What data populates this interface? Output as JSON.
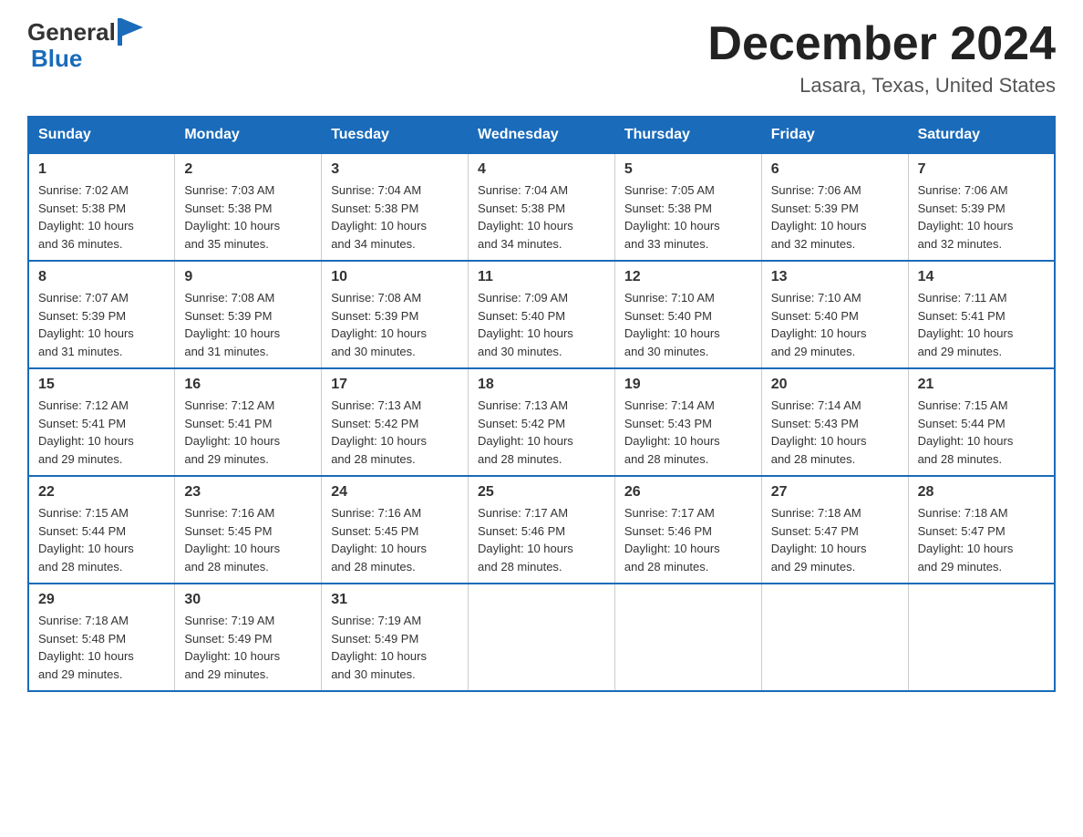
{
  "header": {
    "logo_general": "General",
    "logo_blue": "Blue",
    "month_title": "December 2024",
    "location": "Lasara, Texas, United States"
  },
  "days_of_week": [
    "Sunday",
    "Monday",
    "Tuesday",
    "Wednesday",
    "Thursday",
    "Friday",
    "Saturday"
  ],
  "weeks": [
    [
      {
        "day": "1",
        "sunrise": "7:02 AM",
        "sunset": "5:38 PM",
        "daylight": "10 hours and 36 minutes."
      },
      {
        "day": "2",
        "sunrise": "7:03 AM",
        "sunset": "5:38 PM",
        "daylight": "10 hours and 35 minutes."
      },
      {
        "day": "3",
        "sunrise": "7:04 AM",
        "sunset": "5:38 PM",
        "daylight": "10 hours and 34 minutes."
      },
      {
        "day": "4",
        "sunrise": "7:04 AM",
        "sunset": "5:38 PM",
        "daylight": "10 hours and 34 minutes."
      },
      {
        "day": "5",
        "sunrise": "7:05 AM",
        "sunset": "5:38 PM",
        "daylight": "10 hours and 33 minutes."
      },
      {
        "day": "6",
        "sunrise": "7:06 AM",
        "sunset": "5:39 PM",
        "daylight": "10 hours and 32 minutes."
      },
      {
        "day": "7",
        "sunrise": "7:06 AM",
        "sunset": "5:39 PM",
        "daylight": "10 hours and 32 minutes."
      }
    ],
    [
      {
        "day": "8",
        "sunrise": "7:07 AM",
        "sunset": "5:39 PM",
        "daylight": "10 hours and 31 minutes."
      },
      {
        "day": "9",
        "sunrise": "7:08 AM",
        "sunset": "5:39 PM",
        "daylight": "10 hours and 31 minutes."
      },
      {
        "day": "10",
        "sunrise": "7:08 AM",
        "sunset": "5:39 PM",
        "daylight": "10 hours and 30 minutes."
      },
      {
        "day": "11",
        "sunrise": "7:09 AM",
        "sunset": "5:40 PM",
        "daylight": "10 hours and 30 minutes."
      },
      {
        "day": "12",
        "sunrise": "7:10 AM",
        "sunset": "5:40 PM",
        "daylight": "10 hours and 30 minutes."
      },
      {
        "day": "13",
        "sunrise": "7:10 AM",
        "sunset": "5:40 PM",
        "daylight": "10 hours and 29 minutes."
      },
      {
        "day": "14",
        "sunrise": "7:11 AM",
        "sunset": "5:41 PM",
        "daylight": "10 hours and 29 minutes."
      }
    ],
    [
      {
        "day": "15",
        "sunrise": "7:12 AM",
        "sunset": "5:41 PM",
        "daylight": "10 hours and 29 minutes."
      },
      {
        "day": "16",
        "sunrise": "7:12 AM",
        "sunset": "5:41 PM",
        "daylight": "10 hours and 29 minutes."
      },
      {
        "day": "17",
        "sunrise": "7:13 AM",
        "sunset": "5:42 PM",
        "daylight": "10 hours and 28 minutes."
      },
      {
        "day": "18",
        "sunrise": "7:13 AM",
        "sunset": "5:42 PM",
        "daylight": "10 hours and 28 minutes."
      },
      {
        "day": "19",
        "sunrise": "7:14 AM",
        "sunset": "5:43 PM",
        "daylight": "10 hours and 28 minutes."
      },
      {
        "day": "20",
        "sunrise": "7:14 AM",
        "sunset": "5:43 PM",
        "daylight": "10 hours and 28 minutes."
      },
      {
        "day": "21",
        "sunrise": "7:15 AM",
        "sunset": "5:44 PM",
        "daylight": "10 hours and 28 minutes."
      }
    ],
    [
      {
        "day": "22",
        "sunrise": "7:15 AM",
        "sunset": "5:44 PM",
        "daylight": "10 hours and 28 minutes."
      },
      {
        "day": "23",
        "sunrise": "7:16 AM",
        "sunset": "5:45 PM",
        "daylight": "10 hours and 28 minutes."
      },
      {
        "day": "24",
        "sunrise": "7:16 AM",
        "sunset": "5:45 PM",
        "daylight": "10 hours and 28 minutes."
      },
      {
        "day": "25",
        "sunrise": "7:17 AM",
        "sunset": "5:46 PM",
        "daylight": "10 hours and 28 minutes."
      },
      {
        "day": "26",
        "sunrise": "7:17 AM",
        "sunset": "5:46 PM",
        "daylight": "10 hours and 28 minutes."
      },
      {
        "day": "27",
        "sunrise": "7:18 AM",
        "sunset": "5:47 PM",
        "daylight": "10 hours and 29 minutes."
      },
      {
        "day": "28",
        "sunrise": "7:18 AM",
        "sunset": "5:47 PM",
        "daylight": "10 hours and 29 minutes."
      }
    ],
    [
      {
        "day": "29",
        "sunrise": "7:18 AM",
        "sunset": "5:48 PM",
        "daylight": "10 hours and 29 minutes."
      },
      {
        "day": "30",
        "sunrise": "7:19 AM",
        "sunset": "5:49 PM",
        "daylight": "10 hours and 29 minutes."
      },
      {
        "day": "31",
        "sunrise": "7:19 AM",
        "sunset": "5:49 PM",
        "daylight": "10 hours and 30 minutes."
      },
      null,
      null,
      null,
      null
    ]
  ],
  "labels": {
    "sunrise": "Sunrise:",
    "sunset": "Sunset:",
    "daylight": "Daylight:"
  }
}
